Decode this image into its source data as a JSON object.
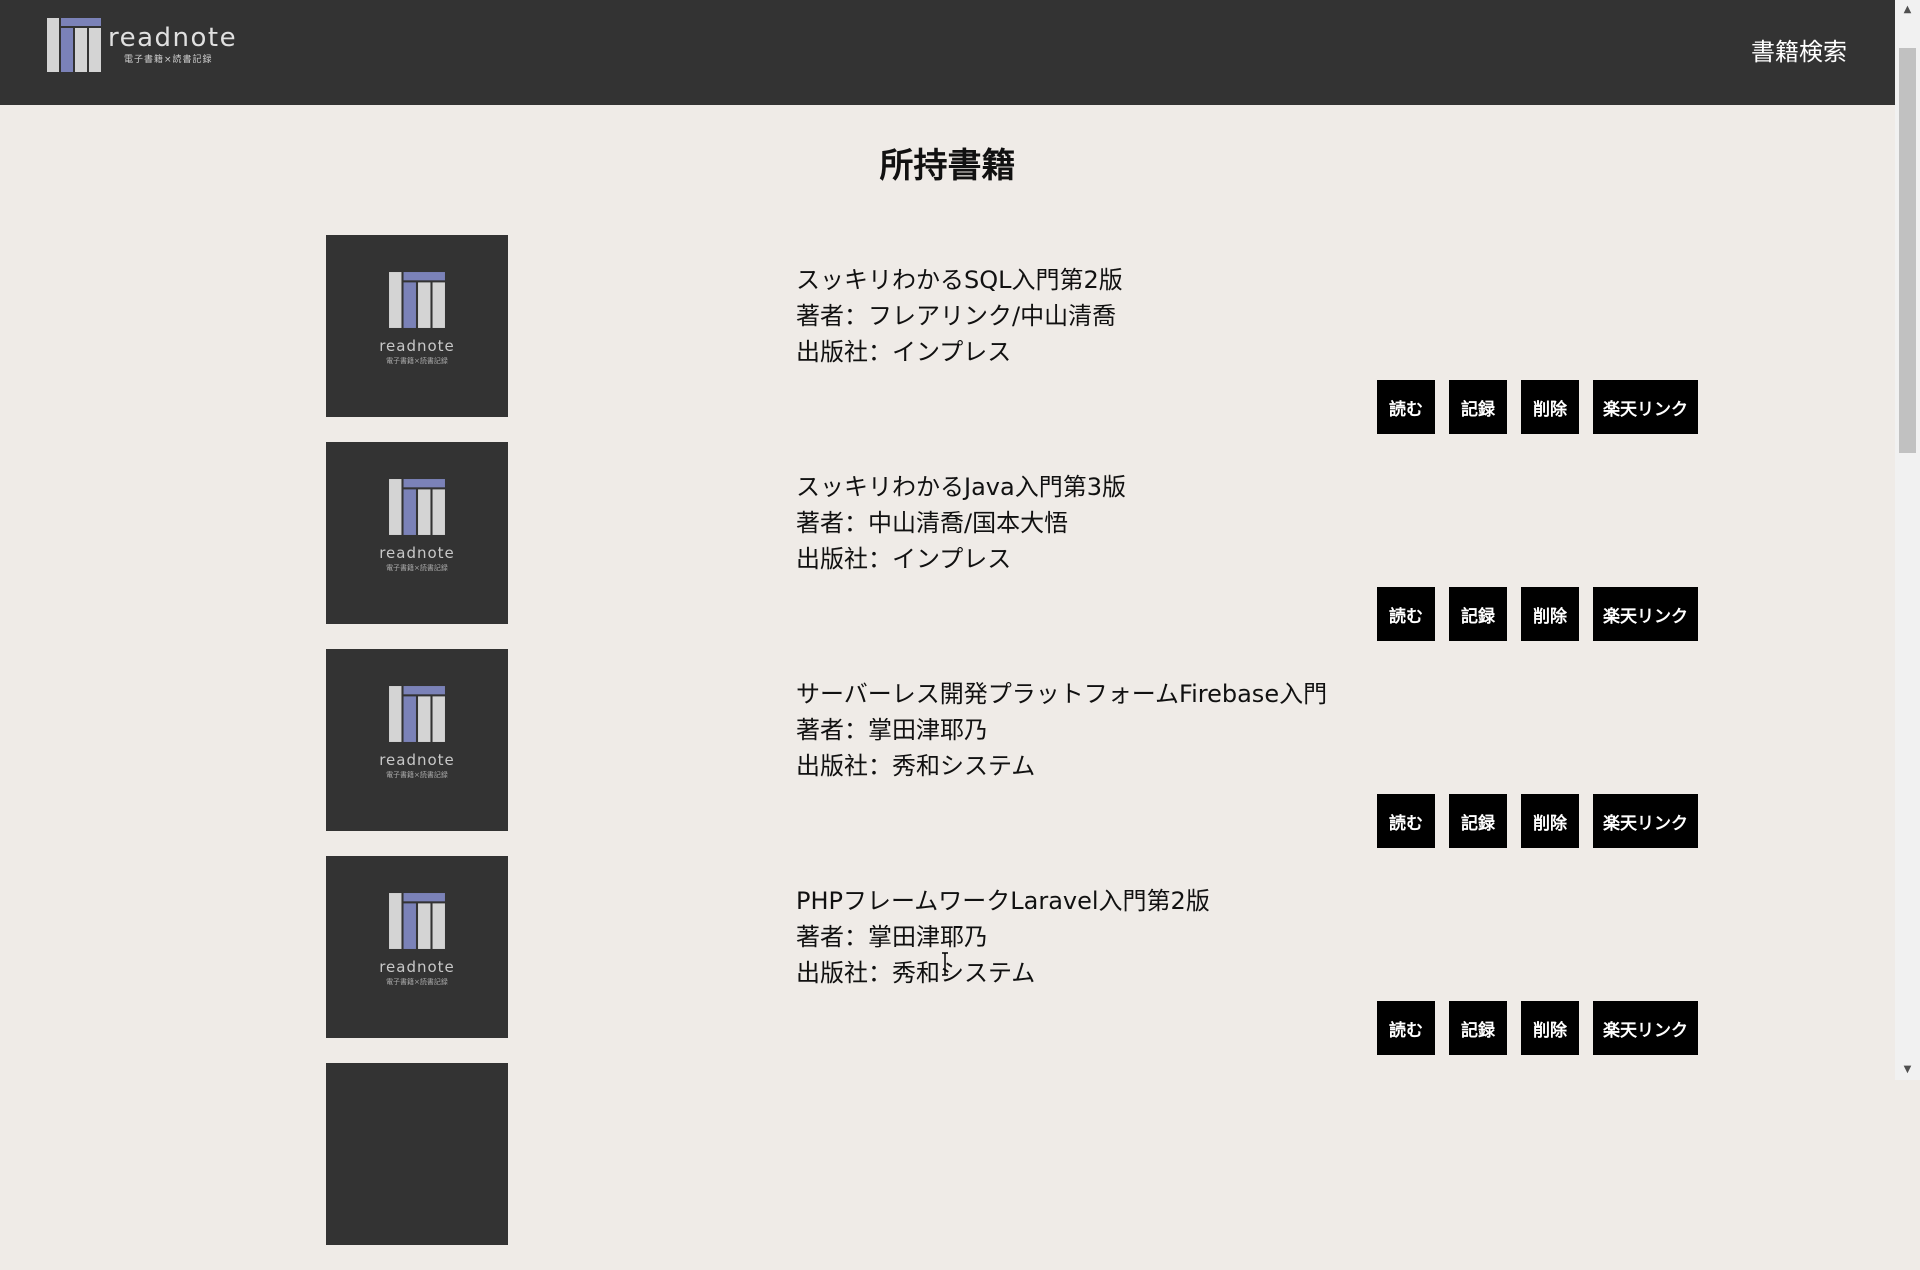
{
  "header": {
    "logo_text": "readnote",
    "logo_subtitle": "電子書籍×読書記録",
    "nav_search": "書籍検索"
  },
  "page": {
    "title": "所持書籍"
  },
  "books": [
    {
      "title": "スッキリわかるSQL入門第2版",
      "author": "著者：フレアリンク/中山清喬",
      "publisher": "出版社：インプレス",
      "cover_text": "readnote",
      "cover_sub": "電子書籍×読書記録"
    },
    {
      "title": "スッキリわかるJava入門第3版",
      "author": "著者：中山清喬/国本大悟",
      "publisher": "出版社：インプレス",
      "cover_text": "readnote",
      "cover_sub": "電子書籍×読書記録"
    },
    {
      "title": "サーバーレス開発プラットフォームFirebase入門",
      "author": "著者：掌田津耶乃",
      "publisher": "出版社：秀和システム",
      "cover_text": "readnote",
      "cover_sub": "電子書籍×読書記録"
    },
    {
      "title": "PHPフレームワークLaravel入門第2版",
      "author": "著者：掌田津耶乃",
      "publisher": "出版社：秀和システム",
      "cover_text": "readnote",
      "cover_sub": "電子書籍×読書記録"
    }
  ],
  "buttons": {
    "read": "読む",
    "record": "記録",
    "delete": "削除",
    "rakuten": "楽天リンク"
  },
  "colors": {
    "header_bg": "#333333",
    "page_bg": "#efebe7",
    "button_bg": "#000000",
    "logo_accent": "#7b82b8",
    "logo_light": "#d4d4d4"
  },
  "icons": {
    "logo": "readnote-logo-icon",
    "cover": "book-cover-placeholder-icon"
  }
}
